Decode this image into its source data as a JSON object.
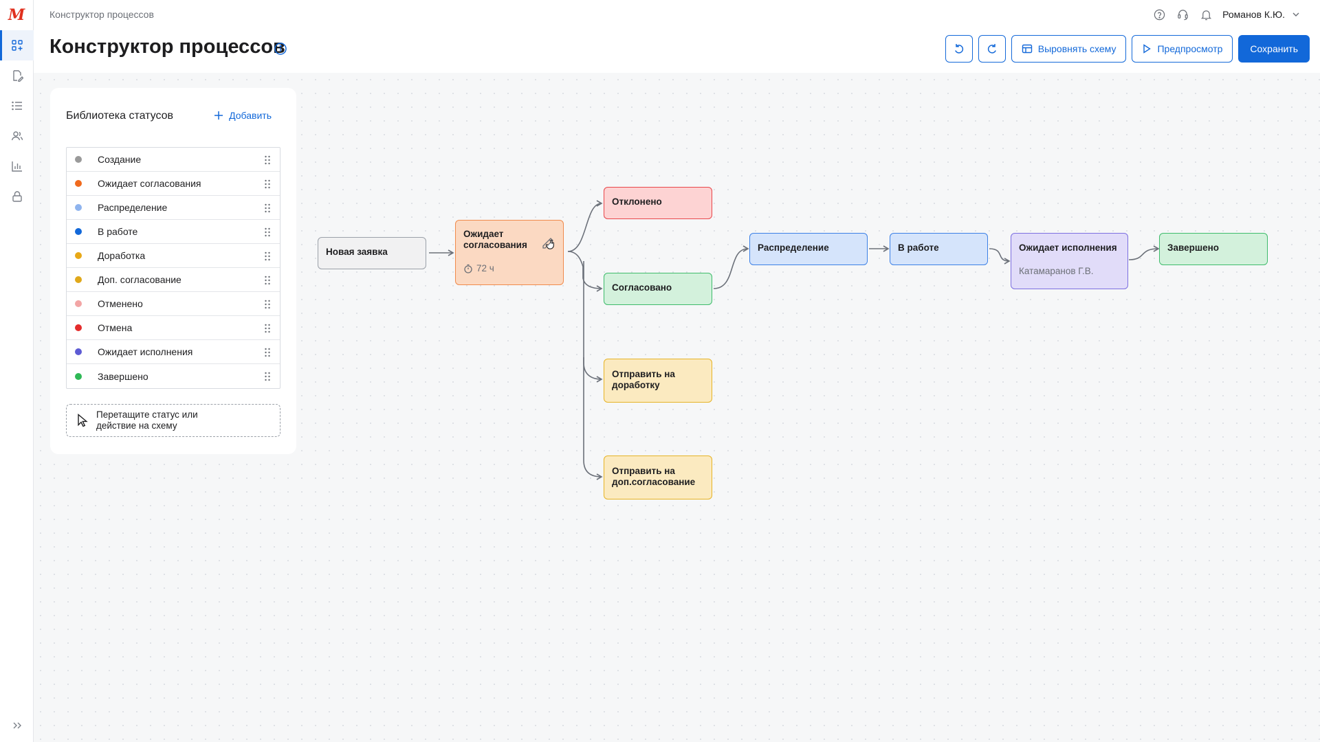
{
  "app": {
    "breadcrumb": "Конструктор процессов",
    "title": "Конструктор процессов",
    "user": "Романов К.Ю."
  },
  "rail": {
    "logo": "М",
    "items": [
      "process-builder-icon",
      "document-edit-icon",
      "list-icon",
      "users-icon",
      "chart-icon",
      "lock-icon"
    ],
    "active": 0
  },
  "toolbar": {
    "align_label": "Выровнять схему",
    "preview_label": "Предпросмотр",
    "save_label": "Сохранить"
  },
  "library": {
    "title": "Библиотека статусов",
    "add_label": "Добавить",
    "items": [
      {
        "label": "Создание",
        "color": "#9a9a9a"
      },
      {
        "label": "Ожидает согласования",
        "color": "#f06a1d"
      },
      {
        "label": "Распределение",
        "color": "#8fb4ee"
      },
      {
        "label": "В работе",
        "color": "#1268d9"
      },
      {
        "label": "Доработка",
        "color": "#e8a817"
      },
      {
        "label": "Доп. согласование",
        "color": "#e0a81a"
      },
      {
        "label": "Отменено",
        "color": "#f2a5a5"
      },
      {
        "label": "Отмена",
        "color": "#e42c2c"
      },
      {
        "label": "Ожидает исполнения",
        "color": "#5d5bd4"
      },
      {
        "label": "Завершено",
        "color": "#2fb956"
      }
    ],
    "dropzone_text": "Перетащите статус или действие на схему"
  },
  "flow": {
    "new_request": "Новая заявка",
    "awaiting_approval": "Ожидает согласования",
    "timer": "72 ч",
    "rejected": "Отклонено",
    "approved": "Согласовано",
    "send_rework": "Отправить на доработку",
    "send_extra_approval": "Отправить на доп.согласование",
    "distribution": "Распределение",
    "in_work": "В работе",
    "awaiting_execution": "Ожидает исполнения",
    "assignee": "Катамаранов Г.В.",
    "completed": "Завершено"
  }
}
